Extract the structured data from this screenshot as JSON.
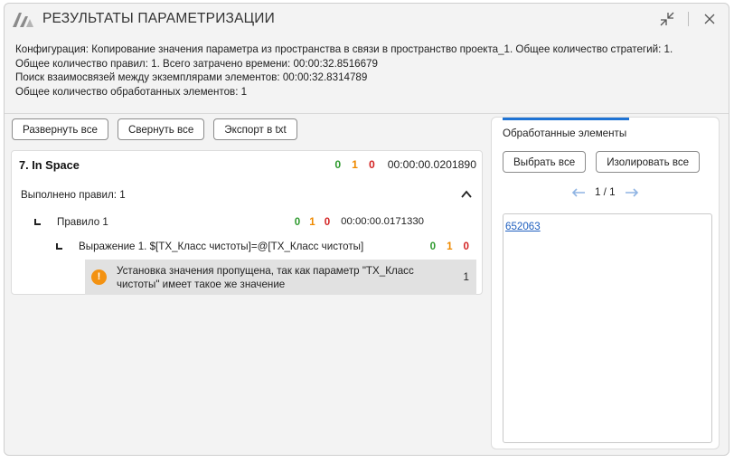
{
  "window": {
    "title": "РЕЗУЛЬТАТЫ ПАРАМЕТРИЗАЦИИ",
    "logo_icon": "twin-chevron-logo",
    "controls": [
      "collapse-icon",
      "close-icon"
    ]
  },
  "info": {
    "lines": [
      "Конфигурация: Копирование значения параметра из пространства в связи в пространство проекта_1. Общее количество стратегий: 1.",
      "Общее количество правил: 1. Всего затрачено времени: 00:00:32.8516679",
      "Поиск взаимосвязей между экземплярами элементов: 00:00:32.8314789",
      "Общее количество обработанных элементов: 1"
    ]
  },
  "toolbar": {
    "expand_all": "Развернуть все",
    "collapse_all": "Свернуть все",
    "export": "Экспорт в txt"
  },
  "result": {
    "title": "7. In Space",
    "counts": {
      "green": "0",
      "orange": "1",
      "red": "0"
    },
    "time": "00:00:00.0201890",
    "rules_done": "Выполнено правил: 1",
    "rule": {
      "label": "Правило 1",
      "counts": {
        "green": "0",
        "orange": "1",
        "red": "0"
      },
      "time": "00:00:00.0171330"
    },
    "expression": {
      "label": "Выражение 1. $[TX_Класс чистоты]=@[TX_Класс чистоты]",
      "counts": {
        "green": "0",
        "orange": "1",
        "red": "0"
      }
    },
    "message": {
      "line1": "Установка значения пропущена, так как параметр  \"TX_Класс",
      "line2": "чистоты\" имеет такое же значение",
      "count": "1"
    }
  },
  "side": {
    "tab": "Обработанные элементы",
    "select_all": "Выбрать все",
    "isolate_all": "Изолировать все",
    "pager": "1 / 1",
    "elements": [
      "652063"
    ]
  },
  "colors": {
    "green": "#2e9a2e",
    "orange": "#ef8a00",
    "red": "#d32424",
    "accent": "#1e73d4",
    "warning": "#f39212",
    "link": "#1f5fbf"
  }
}
